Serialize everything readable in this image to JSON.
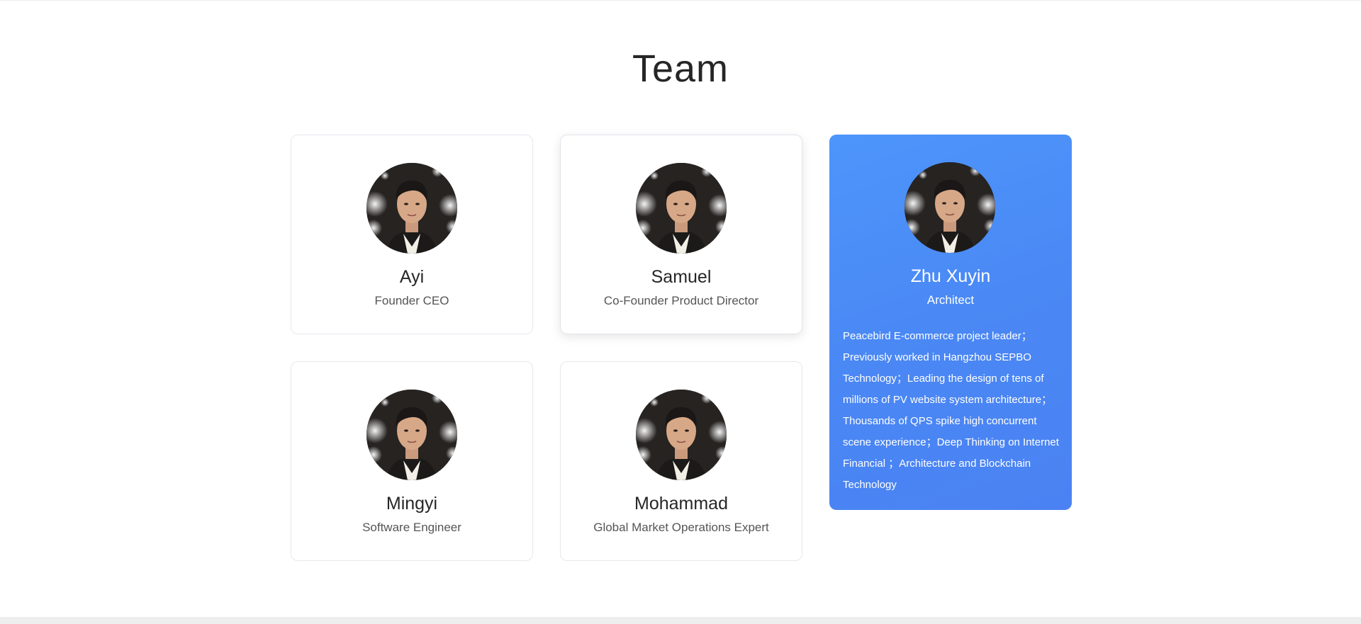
{
  "section": {
    "title": "Team"
  },
  "members": [
    {
      "name": "Ayi",
      "role": "Founder CEO"
    },
    {
      "name": "Samuel",
      "role": "Co-Founder Product Director"
    },
    {
      "name": "Zhu Xuyin",
      "role": "Architect",
      "bio": "Peacebird E-commerce project leader；Previously worked in Hangzhou SEPBO Technology；Leading the design of tens of millions of PV website system architecture；Thousands of QPS spike high concurrent scene experience；Deep Thinking on Internet Financial ；Architecture and Blockchain Technology"
    },
    {
      "name": "Mingyi",
      "role": "Software Engineer"
    },
    {
      "name": "Mohammad",
      "role": "Global Market Operations Expert"
    }
  ],
  "colors": {
    "featured_card": "#4a8cf7",
    "card_border": "#e6e8ee",
    "title_text": "#262626"
  }
}
